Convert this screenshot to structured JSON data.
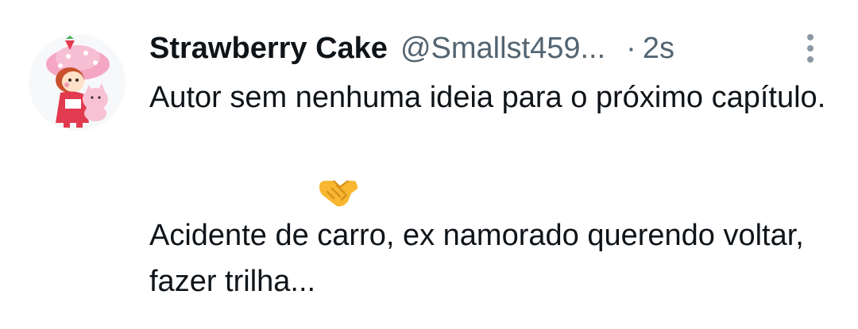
{
  "tweet": {
    "display_name": "Strawberry Cake",
    "handle": "@Smallst459...",
    "separator": "·",
    "timestamp": "2s",
    "paragraph_1": "Autor sem nenhuma ideia para o próximo capítulo.",
    "emoji": "handshake-emoji",
    "paragraph_2": "Acidente de carro, ex namorado querendo voltar, fazer trilha..."
  },
  "icons": {
    "avatar": "strawberry-shortcake-avatar",
    "more": "more-vertical-icon"
  },
  "colors": {
    "text_primary": "#0f1419",
    "text_secondary": "#536471",
    "emoji": "#f7b731"
  }
}
